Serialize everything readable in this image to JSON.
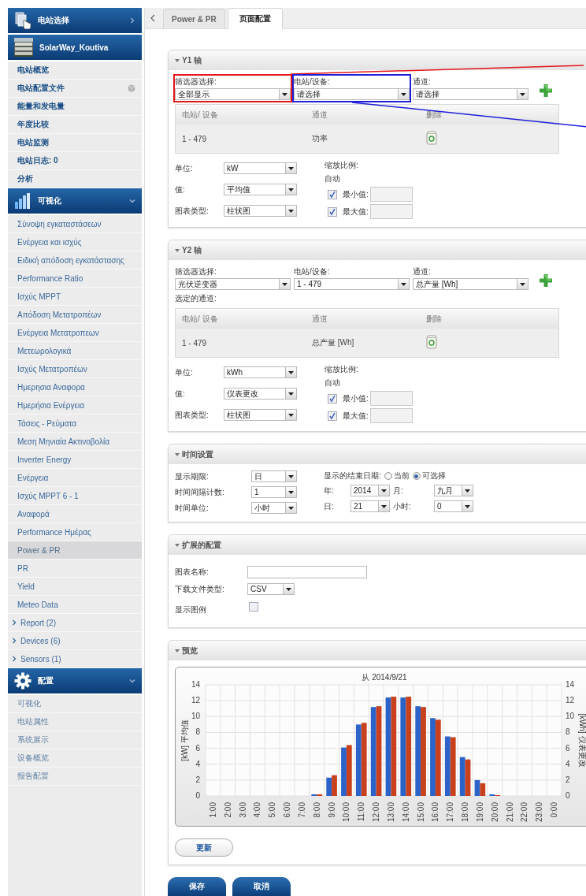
{
  "sidebar": {
    "plant_selector": {
      "label": "电站选择",
      "expanded": false
    },
    "plant": {
      "name": "SolarWay_Koutiva"
    },
    "plant_items": [
      {
        "label": "电站概览",
        "kind": "link"
      },
      {
        "label": "电站配置文件",
        "kind": "globe"
      },
      {
        "label": "能量和发电量",
        "kind": "link"
      },
      {
        "label": "年度比较",
        "kind": "link"
      },
      {
        "label": "电站监测",
        "kind": "link"
      },
      {
        "label": "电站日志: 0",
        "kind": "link"
      },
      {
        "label": "分析",
        "kind": "link"
      }
    ],
    "visualization": {
      "label": "可视化",
      "expanded": true
    },
    "view_items": [
      {
        "label": "Σύνοψη εγκαταστάσεων",
        "selected": false
      },
      {
        "label": "Ενέργεια και ισχύς",
        "selected": false
      },
      {
        "label": "Ειδική απόδοση εγκατάστασης",
        "selected": false
      },
      {
        "label": "Performance Ratio",
        "selected": false
      },
      {
        "label": "Ισχύς MPPT",
        "selected": false
      },
      {
        "label": "Απόδοση Μετατροπέων",
        "selected": false
      },
      {
        "label": "Ενέργεια Μετατροπεων",
        "selected": false
      },
      {
        "label": "Μετεωρολογικά",
        "selected": false
      },
      {
        "label": "Ισχύς Μετατροπέων",
        "selected": false
      },
      {
        "label": "Ημερησια Αναφορα",
        "selected": false
      },
      {
        "label": "Ημερήσια Ενέργεια",
        "selected": false
      },
      {
        "label": "Τάσεις - Ρεύματα",
        "selected": false
      },
      {
        "label": "Μεση Μηνιαία Ακτινοβολία",
        "selected": false
      },
      {
        "label": "Inverter Energy",
        "selected": false
      },
      {
        "label": "Ενέργεια",
        "selected": false
      },
      {
        "label": "Ισχύς MPPT 6 - 1",
        "selected": false
      },
      {
        "label": "Αναφορά",
        "selected": false
      },
      {
        "label": "Performance Ημέρας",
        "selected": false
      },
      {
        "label": "Power & PR",
        "selected": true
      },
      {
        "label": "PR",
        "selected": false
      },
      {
        "label": "Yield",
        "selected": false
      },
      {
        "label": "Meteo Data",
        "selected": false
      }
    ],
    "view_groups": [
      {
        "label": "Report (2)",
        "expanded": false
      },
      {
        "label": "Devices (6)",
        "expanded": false
      },
      {
        "label": "Sensors (1)",
        "expanded": false
      }
    ],
    "config": {
      "label": "配置",
      "expanded": true
    },
    "config_items": [
      {
        "label": "可视化"
      },
      {
        "label": "电站属性"
      },
      {
        "label": "系统展示"
      },
      {
        "label": "设备概览"
      },
      {
        "label": "报告配置"
      }
    ]
  },
  "tabs": [
    {
      "label": "Power & PR",
      "selected": false
    },
    {
      "label": "页面配置",
      "selected": true
    }
  ],
  "y1_axis": {
    "title": "Y1 轴",
    "expanded": true,
    "filters": [
      {
        "label": "筛选器选择:",
        "value": "全部显示"
      },
      {
        "label": "电站/设备:",
        "value": "请选择"
      },
      {
        "label": "通道:",
        "value": "请选择"
      }
    ],
    "table": {
      "columns": [
        "电站/ 设备",
        "通道",
        "删除"
      ],
      "rows": [
        {
          "device": "1 - 479",
          "channel": "功率"
        }
      ]
    },
    "settings": [
      {
        "label": "单位:",
        "value": "kW"
      },
      {
        "label": "值:",
        "value": "平均值"
      },
      {
        "label": "图表类型:",
        "value": "柱状图"
      }
    ],
    "scale": {
      "label": "缩放比例:",
      "mode": "自动",
      "limits": [
        {
          "label": "最小值:",
          "checked": true
        },
        {
          "label": "最大值:",
          "checked": true
        }
      ]
    },
    "annotations": [
      {
        "color": "#e3141b"
      },
      {
        "color": "#1f1fd8"
      }
    ]
  },
  "y2_axis": {
    "title": "Y2 轴",
    "expanded": true,
    "filters": [
      {
        "label": "筛选器选择:",
        "value": "光伏逆变器"
      },
      {
        "label": "电站/设备:",
        "value": "1 - 479"
      },
      {
        "label": "通道:",
        "value": "总产量 [Wh]"
      }
    ],
    "selected_label": "选定的通道:",
    "table": {
      "columns": [
        "电站/ 设备",
        "通道",
        "删除"
      ],
      "rows": [
        {
          "device": "1 - 479",
          "channel": "总产量 [Wh]"
        }
      ]
    },
    "settings": [
      {
        "label": "单位:",
        "value": "kWh"
      },
      {
        "label": "值:",
        "value": "仪表更改"
      },
      {
        "label": "图表类型:",
        "value": "柱状图"
      }
    ],
    "scale": {
      "label": "缩放比例:",
      "mode": "自动",
      "limits": [
        {
          "label": "最小值:",
          "checked": true
        },
        {
          "label": "最大值:",
          "checked": true
        }
      ]
    }
  },
  "time_settings": {
    "title": "时间设置",
    "expanded": true,
    "fields": [
      {
        "label": "显示期限:",
        "value": "日"
      },
      {
        "label": "时间间隔计数:",
        "value": "1"
      },
      {
        "label": "时间单位:",
        "value": "小时"
      }
    ],
    "end_date": {
      "label": "显示的结束日期:",
      "options": [
        {
          "label": "当前",
          "selected": false
        },
        {
          "label": "可选择",
          "selected": true
        }
      ]
    },
    "date_fields": [
      {
        "label": "年:",
        "value": "2014"
      },
      {
        "label": "月:",
        "value": "九月"
      },
      {
        "label": "日:",
        "value": "21"
      },
      {
        "label": "小时:",
        "value": "0"
      }
    ]
  },
  "extended": {
    "title": "扩展的配置",
    "expanded": true,
    "chart_name": {
      "label": "图表名称:"
    },
    "file_type": {
      "label": "下载文件类型:",
      "value": "CSV"
    },
    "legend": {
      "label": "显示图例",
      "checked": false
    }
  },
  "preview": {
    "title": "预览",
    "expanded": true,
    "chart_data": {
      "type": "bar",
      "title": "从 2014/9/21",
      "ylabel": "[kW] 平均值",
      "y2label": "[kWh] 仪表更改",
      "categories": [
        "1:00",
        "2:00",
        "3:00",
        "4:00",
        "5:00",
        "6:00",
        "7:00",
        "8:00",
        "9:00",
        "10:00",
        "11:00",
        "12:00",
        "13:00",
        "14:00",
        "15:00",
        "16:00",
        "17:00",
        "18:00",
        "19:00",
        "20:00",
        "21:00",
        "22:00",
        "23:00",
        "0:00"
      ],
      "ylim": [
        0,
        14
      ],
      "yticks": [
        0,
        2,
        4,
        6,
        8,
        10,
        12,
        14
      ],
      "y2lim": [
        0,
        14
      ],
      "y2ticks": [
        0,
        2,
        4,
        6,
        8,
        10,
        12,
        14
      ],
      "grid": true,
      "series": [
        {
          "color": "#2c63c8",
          "values": [
            0,
            0,
            0,
            0,
            0,
            0,
            0,
            0.2,
            2.3,
            6.1,
            9.0,
            11.2,
            12.4,
            12.4,
            11.3,
            9.8,
            7.5,
            4.9,
            2.0,
            0.2,
            0,
            0,
            0,
            0
          ]
        },
        {
          "color": "#c8401c",
          "values": [
            0,
            0,
            0,
            0,
            0,
            0,
            0,
            0.2,
            2.6,
            6.4,
            9.2,
            11.3,
            12.5,
            12.5,
            11.2,
            9.6,
            7.4,
            4.6,
            1.6,
            0.1,
            0,
            0,
            0,
            0
          ]
        }
      ]
    },
    "refresh_button": "更新"
  },
  "buttons": [
    {
      "label": "保存"
    },
    {
      "label": "取消"
    }
  ]
}
